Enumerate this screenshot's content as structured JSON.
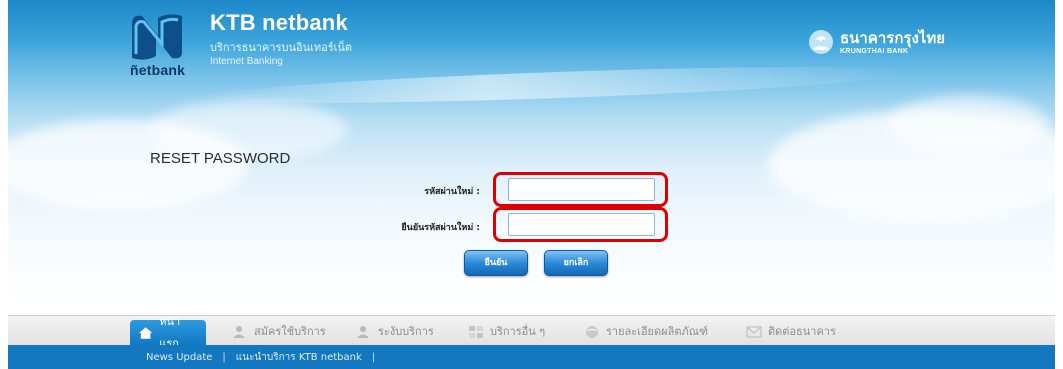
{
  "header": {
    "logo_word": "ñetbank",
    "brand_title": "KTB netbank",
    "brand_thai": "บริการธนาคารบนอินเทอร์เน็ต",
    "brand_en": "Internet Banking",
    "bank_name_thai": "ธนาคารกรุงไทย",
    "bank_name_en": "KRUNGTHAI BANK"
  },
  "form": {
    "title": "RESET PASSWORD",
    "new_password_label": "รหัสผ่านใหม่ :",
    "confirm_password_label": "ยืนยันรหัสผ่านใหม่ :",
    "new_password_value": "",
    "confirm_password_value": "",
    "confirm_button": "ยืนยัน",
    "cancel_button": "ยกเลิก"
  },
  "nav": {
    "tabs": [
      {
        "label": "หน้าแรก",
        "icon": "home-icon",
        "active": true
      },
      {
        "label": "สมัครใช้บริการ",
        "icon": "user-icon"
      },
      {
        "label": "ระงับบริการ",
        "icon": "user-icon"
      },
      {
        "label": "บริการอื่น ๆ",
        "icon": "grid-icon"
      },
      {
        "label": "รายละเอียดผลิตภัณฑ์",
        "icon": "globe-icon"
      },
      {
        "label": "ติดต่อธนาคาร",
        "icon": "mail-icon"
      }
    ]
  },
  "subbar": {
    "link1": "News Update",
    "link2": "แนะนำบริการ KTB netbank",
    "sep": "|"
  },
  "colors": {
    "highlight": "#e00000",
    "accent": "#1478c0"
  }
}
